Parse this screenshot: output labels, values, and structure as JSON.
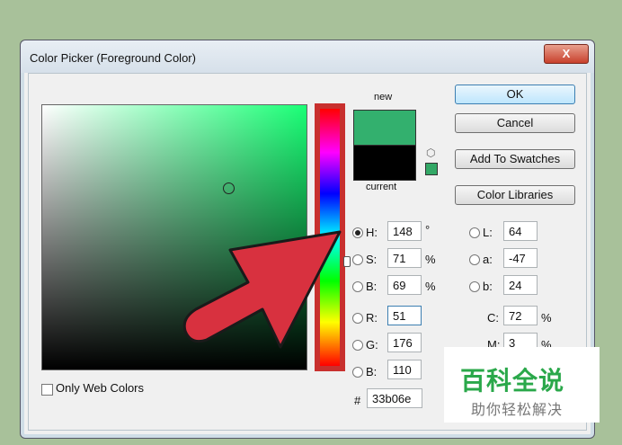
{
  "dialog": {
    "title": "Color Picker (Foreground Color)",
    "close_glyph": "X"
  },
  "preview": {
    "new_label": "new",
    "current_label": "current",
    "new_color": "#33b06e",
    "current_color": "#000000"
  },
  "buttons": {
    "ok": "OK",
    "cancel": "Cancel",
    "add_swatches": "Add To Swatches",
    "color_libraries": "Color Libraries"
  },
  "fields": {
    "H": {
      "label": "H:",
      "value": "148",
      "unit": "°"
    },
    "S": {
      "label": "S:",
      "value": "71",
      "unit": "%"
    },
    "Bv": {
      "label": "B:",
      "value": "69",
      "unit": "%"
    },
    "R": {
      "label": "R:",
      "value": "51"
    },
    "G": {
      "label": "G:",
      "value": "176"
    },
    "Bl": {
      "label": "B:",
      "value": "110"
    },
    "L": {
      "label": "L:",
      "value": "64"
    },
    "a": {
      "label": "a:",
      "value": "-47"
    },
    "b": {
      "label": "b:",
      "value": "24"
    },
    "C": {
      "label": "C:",
      "value": "72",
      "unit": "%"
    },
    "M": {
      "label": "M:",
      "value": "3",
      "unit": "%"
    },
    "hex": {
      "label": "#",
      "value": "33b06e"
    }
  },
  "only_web_colors": {
    "label": "Only Web Colors",
    "checked": false
  },
  "selected_radio": "H",
  "annotation": {
    "arrow_color": "#d8313f"
  },
  "watermark": {
    "main": "百科全说",
    "sub": "助你轻松解决"
  }
}
